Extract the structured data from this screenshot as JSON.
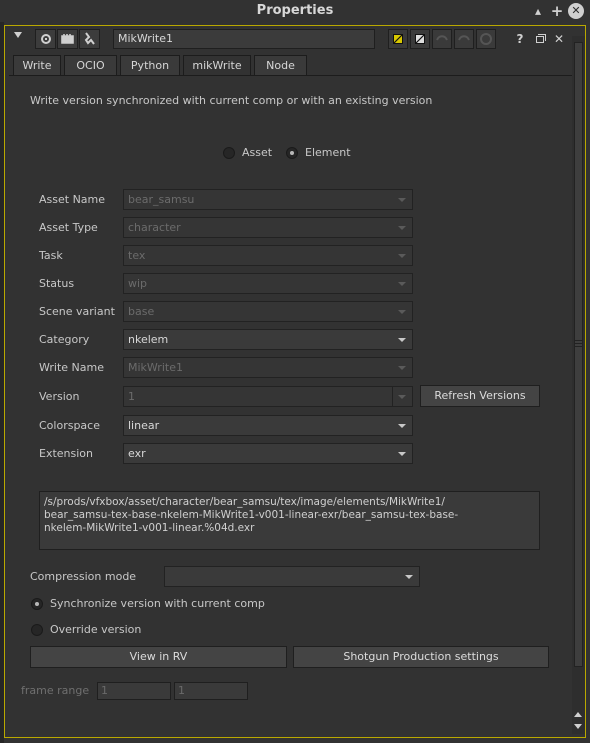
{
  "window": {
    "title": "Properties"
  },
  "node": {
    "name": "MikWrite1"
  },
  "tabs": [
    {
      "label": "Write"
    },
    {
      "label": "OCIO"
    },
    {
      "label": "Python"
    },
    {
      "label": "mikWrite",
      "active": true
    },
    {
      "label": "Node"
    }
  ],
  "description": "Write version synchronized with current comp or with an existing version",
  "mode": {
    "asset_label": "Asset",
    "element_label": "Element",
    "selected": "Element"
  },
  "fields": [
    {
      "label": "Asset Name",
      "value": "bear_samsu",
      "enabled": false
    },
    {
      "label": "Asset Type",
      "value": "character",
      "enabled": false
    },
    {
      "label": "Task",
      "value": "tex",
      "enabled": false
    },
    {
      "label": "Status",
      "value": "wip",
      "enabled": false
    },
    {
      "label": "Scene variant",
      "value": "base",
      "enabled": false
    },
    {
      "label": "Category",
      "value": "nkelem",
      "enabled": true
    },
    {
      "label": "Write Name",
      "value": "MikWrite1",
      "enabled": false
    },
    {
      "label": "Version",
      "value": "1",
      "enabled": false
    },
    {
      "label": "Colorspace",
      "value": "linear",
      "enabled": true
    },
    {
      "label": "Extension",
      "value": "exr",
      "enabled": true
    }
  ],
  "refresh_button": "Refresh Versions",
  "output_path": "/s/prods/vfxbox/asset/character/bear_samsu/tex/image/elements/MikWrite1/\nbear_samsu-tex-base-nkelem-MikWrite1-v001-linear-exr/bear_samsu-tex-base-\nnkelem-MikWrite1-v001-linear.%04d.exr",
  "compression": {
    "label": "Compression mode",
    "value": ""
  },
  "sync_option": {
    "sync_label": "Synchronize version with current comp",
    "override_label": "Override version",
    "selected": "sync"
  },
  "buttons": {
    "view_rv": "View in RV",
    "shotgun": "Shotgun Production settings"
  },
  "frame_range": {
    "label": "frame range",
    "start": "1",
    "end": "1"
  },
  "colors": {
    "accent_border": "#b9a800",
    "background": "#323232"
  }
}
